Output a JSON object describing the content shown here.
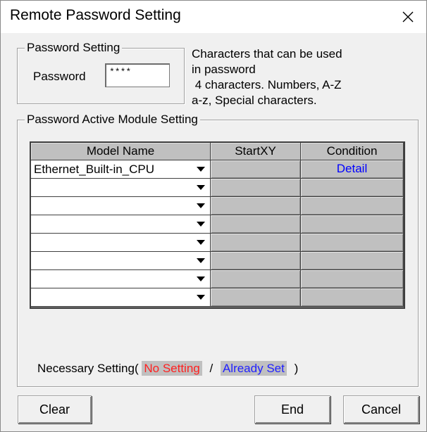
{
  "window": {
    "title": "Remote Password Setting"
  },
  "password_group": {
    "legend": "Password Setting",
    "password_label": "Password",
    "password_value": "****"
  },
  "info_lines": [
    "Characters that can be used",
    "in password",
    " 4 characters. Numbers, A-Z",
    "a-z, Special characters."
  ],
  "module_group": {
    "legend": "Password Active Module Setting",
    "columns": [
      "Model Name",
      "StartXY",
      "Condition"
    ],
    "rows": [
      {
        "model": "Ethernet_Built-in_CPU",
        "startxy": "",
        "condition": "Detail"
      },
      {
        "model": "",
        "startxy": "",
        "condition": ""
      },
      {
        "model": "",
        "startxy": "",
        "condition": ""
      },
      {
        "model": "",
        "startxy": "",
        "condition": ""
      },
      {
        "model": "",
        "startxy": "",
        "condition": ""
      },
      {
        "model": "",
        "startxy": "",
        "condition": ""
      },
      {
        "model": "",
        "startxy": "",
        "condition": ""
      },
      {
        "model": "",
        "startxy": "",
        "condition": ""
      }
    ]
  },
  "legend_footer": {
    "prefix": "Necessary Setting(",
    "no_setting": "No Setting",
    "separator": "/",
    "already_set": "Already Set",
    "suffix": ")"
  },
  "buttons": {
    "clear": "Clear",
    "end": "End",
    "cancel": "Cancel"
  },
  "colors": {
    "no_setting_text": "#ff2020",
    "already_set_text": "#1f1fff",
    "link": "#0000ff",
    "cell_gray": "#c0c0c0"
  },
  "icons": {
    "close": "close-icon",
    "dropdown": "chevron-down-icon"
  }
}
